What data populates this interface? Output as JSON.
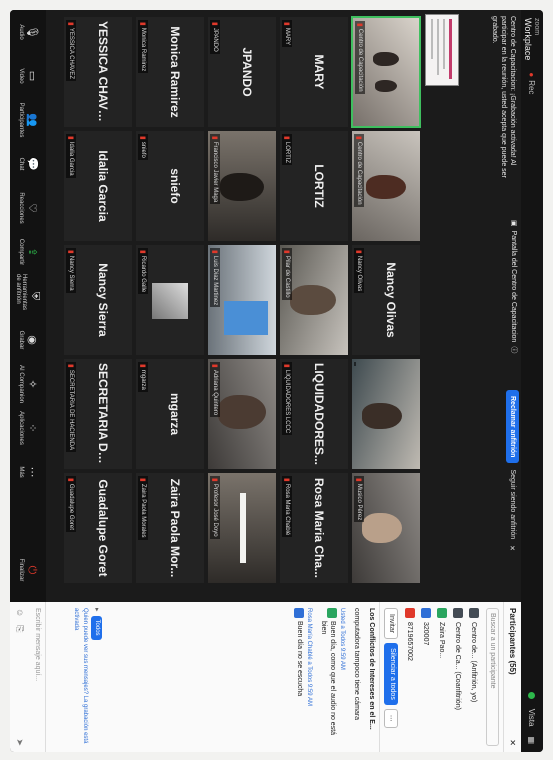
{
  "window": {
    "brand_small": "zoom",
    "brand": "Workplace",
    "view_label": "Vista",
    "top_item": "Rec",
    "host_banner": "Pantalla del Centro de Capacitacion"
  },
  "notice": {
    "text": "Centro de Capacitacion: ¡Grabación activada! Al participar en la reunión, usted acepta que puede ser grabado."
  },
  "claim": {
    "button": "Reclamar anfitrión",
    "text": "Seguir siendo anfitrión"
  },
  "tiles": [
    {
      "id": "t1",
      "name": "",
      "label": "Centro de Capacitación",
      "video": true
    },
    {
      "id": "t2",
      "name": "",
      "label": "Centro de Capacitación",
      "video": true
    },
    {
      "id": "t3",
      "name": "Nancy Olivas",
      "label": "Nancy Olivas",
      "video": false
    },
    {
      "id": "t4",
      "name": "",
      "label": "",
      "video": true
    },
    {
      "id": "t5",
      "name": "",
      "label": "Musico Pérez",
      "video": true
    },
    {
      "id": "t6",
      "name": "MARY",
      "label": "MARY",
      "video": false
    },
    {
      "id": "t7",
      "name": "LORTIZ",
      "label": "LORTIZ",
      "video": false
    },
    {
      "id": "t8",
      "name": "",
      "label": "Pilar de Castillo",
      "video": true
    },
    {
      "id": "t9",
      "name": "LIQUIDADORES...",
      "label": "LIQUIDADORES LCCC",
      "video": false
    },
    {
      "id": "t10",
      "name": "Rosa Maria Cha...",
      "label": "Rosa Maria Chablé",
      "video": false
    },
    {
      "id": "t11",
      "name": "JPANDO",
      "label": "JPANDO",
      "video": false
    },
    {
      "id": "t12",
      "name": "",
      "label": "Francisco Javier Maga",
      "video": true
    },
    {
      "id": "t13",
      "name": "",
      "label": "Luis Diaz Martinez",
      "video": true
    },
    {
      "id": "t14",
      "name": "",
      "label": "Adriana Quintero",
      "video": true
    },
    {
      "id": "t15",
      "name": "",
      "label": "Profesor José Doyo",
      "video": true
    },
    {
      "id": "t16",
      "name": "Monica Ramirez",
      "label": "Monica Ramirez",
      "video": false
    },
    {
      "id": "t17",
      "name": "sniefo",
      "label": "sniefo",
      "video": false
    },
    {
      "id": "t18",
      "name": "",
      "label": "Ricardo Galle",
      "video": true
    },
    {
      "id": "t19",
      "name": "mgarza",
      "label": "mgarza",
      "video": false
    },
    {
      "id": "t20",
      "name": "Zaira Paola Mor...",
      "label": "Zaira Paola Morales",
      "video": false
    },
    {
      "id": "t21",
      "name": "YESSICA CHAVEZ",
      "label": "YESSICA CHAVEZ",
      "video": false
    },
    {
      "id": "t22",
      "name": "Idalia Garcia",
      "label": "Idalia Garcia",
      "video": false
    },
    {
      "id": "t23",
      "name": "Nancy Sierra",
      "label": "Nancy Sierra",
      "video": false
    },
    {
      "id": "t24",
      "name": "SECRETARIA DE...",
      "label": "SECRETARIA DE HACIENDA",
      "video": false
    },
    {
      "id": "t25",
      "name": "Guadalupe Goret",
      "label": "Guadalupe Goret",
      "video": false
    }
  ],
  "toolbar": [
    {
      "label": "Audio",
      "icon": "mic-icon",
      "glyph": "🎙"
    },
    {
      "label": "Video",
      "icon": "camera-icon",
      "glyph": "▭"
    },
    {
      "label": "Participantes",
      "icon": "people-icon",
      "glyph": "👥"
    },
    {
      "label": "Chat",
      "icon": "chat-icon",
      "glyph": "💬"
    },
    {
      "label": "Reacciones",
      "icon": "reaction-icon",
      "glyph": "♡"
    },
    {
      "label": "Compartir",
      "icon": "share-icon",
      "glyph": "⇪"
    },
    {
      "label": "Herramientas de anfitrión",
      "icon": "shield-icon",
      "glyph": "⛨"
    },
    {
      "label": "Grabar",
      "icon": "record-icon",
      "glyph": "◉"
    },
    {
      "label": "AI Companion",
      "icon": "sparkle-icon",
      "glyph": "✧"
    },
    {
      "label": "Aplicaciones",
      "icon": "apps-icon",
      "glyph": "⁘"
    },
    {
      "label": "Más",
      "icon": "more-icon",
      "glyph": "⋯"
    }
  ],
  "end_button": "Finalizar",
  "sidebar": {
    "participants_title": "Participantes (55)",
    "search_placeholder": "Buscar a un participante",
    "participants": [
      {
        "name": "Centro de... (Anfitrión, yo)",
        "color": "#444c55"
      },
      {
        "name": "Centro de Ca... (Coanfitrión)",
        "color": "#444c55"
      },
      {
        "name": "Zaira Pao...",
        "color": "#2aa55f"
      },
      {
        "name": "320007",
        "color": "#2f6fd6"
      },
      {
        "name": "8719657002",
        "color": "#e0392b"
      }
    ],
    "invite_button": "Invitar",
    "mute_all_button": "Silenciar a todos",
    "chat_title": "Los Conflictos de Intereses en el E...",
    "messages": [
      {
        "meta": "",
        "text": "computadora tampoco tiene cámara"
      },
      {
        "meta": "Usted a Todos 9:59 AM",
        "text": "Buen día, como que el audio no está bien"
      },
      {
        "meta": "Rosa María Chablé a Todos 9:59 AM",
        "text": "Buen día no se escucha"
      }
    ],
    "to_label": "Todos",
    "recording_note": "Quien puede ver sus mensajes? La grabación está activada",
    "compose_placeholder": "Escribir mensaje aquí..."
  }
}
